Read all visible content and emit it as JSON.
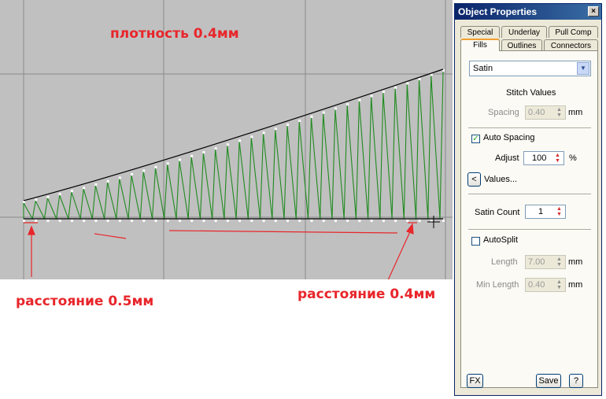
{
  "annotations": {
    "density": "плотность 0.4мм",
    "distance_left": "расстояние 0.5мм",
    "distance_right": "расстояние 0.4мм"
  },
  "colors": {
    "canvas_bg": "#c0c0c0",
    "stitch": "#1f8a1f",
    "annotation": "#e8262b",
    "panel_bg": "#ece9d8",
    "title_bar": "#0a246a"
  },
  "panel": {
    "title": "Object Properties",
    "close_symbol": "×",
    "tabs_row1": [
      "Special",
      "Underlay",
      "Pull Comp"
    ],
    "tabs_row2": [
      "Fills",
      "Outlines",
      "Connectors"
    ],
    "active_tab": "Fills",
    "fill_type": "Satin",
    "stitch_values_heading": "Stitch Values",
    "spacing": {
      "label": "Spacing",
      "value": "0.40",
      "unit": "mm",
      "enabled": false
    },
    "auto_spacing": {
      "label": "Auto Spacing",
      "checked": true
    },
    "adjust": {
      "label": "Adjust",
      "value": "100",
      "unit": "%"
    },
    "values_button": "Values...",
    "values_icon_symbol": "<",
    "satin_count": {
      "label": "Satin Count",
      "value": "1"
    },
    "autosplit": {
      "label": "AutoSplit",
      "checked": false
    },
    "length": {
      "label": "Length",
      "value": "7.00",
      "unit": "mm",
      "enabled": false
    },
    "min_length": {
      "label": "Min Length",
      "value": "0.40",
      "unit": "mm",
      "enabled": false
    },
    "fx_button": "FX",
    "save_button": "Save",
    "help_button": "?"
  }
}
